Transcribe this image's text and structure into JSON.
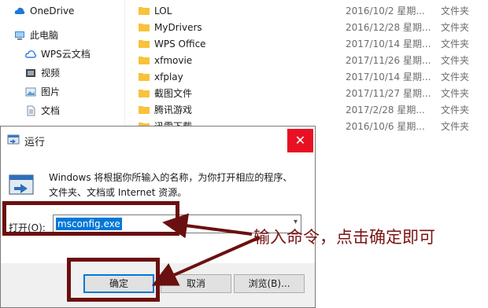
{
  "sidebar": {
    "items": [
      {
        "label": "OneDrive",
        "icon": "cloud-icon"
      },
      {
        "label": "此电脑",
        "icon": "computer-icon"
      },
      {
        "label": "WPS云文档",
        "icon": "wps-cloud-icon"
      },
      {
        "label": "视频",
        "icon": "video-icon"
      },
      {
        "label": "图片",
        "icon": "picture-icon"
      },
      {
        "label": "文档",
        "icon": "document-icon"
      }
    ]
  },
  "files": [
    {
      "name": "LOL",
      "date": "2016/10/2 星期...",
      "type": "文件夹"
    },
    {
      "name": "MyDrivers",
      "date": "2016/12/28 星期...",
      "type": "文件夹"
    },
    {
      "name": "WPS Office",
      "date": "2017/10/14 星期...",
      "type": "文件夹"
    },
    {
      "name": "xfmovie",
      "date": "2017/11/26 星期...",
      "type": "文件夹"
    },
    {
      "name": "xfplay",
      "date": "2017/10/14 星期...",
      "type": "文件夹"
    },
    {
      "name": "截图文件",
      "date": "2017/11/27 星期...",
      "type": "文件夹"
    },
    {
      "name": "腾讯游戏",
      "date": "2017/2/28 星期...",
      "type": "文件夹"
    },
    {
      "name": "迅雷下载",
      "date": "2016/10/6 星期...",
      "type": "文件夹"
    }
  ],
  "dialog": {
    "title": "运行",
    "close_symbol": "✕",
    "description": "Windows 将根据你所输入的名称，为你打开相应的程序、文件夹、文档或 Internet 资源。",
    "open_label": "打开(O):",
    "command_value": "msconfig.exe",
    "ok_label": "确定",
    "cancel_label": "取消",
    "browse_label": "浏览(B)..."
  },
  "annotation": {
    "text": "输入命令，点击确定即可",
    "color": "#7a1313"
  },
  "colors": {
    "close_red": "#e81123",
    "selection_blue": "#0078d7",
    "folder_yellow": "#f8c23b",
    "annotation_dark_red": "#6b1010"
  }
}
